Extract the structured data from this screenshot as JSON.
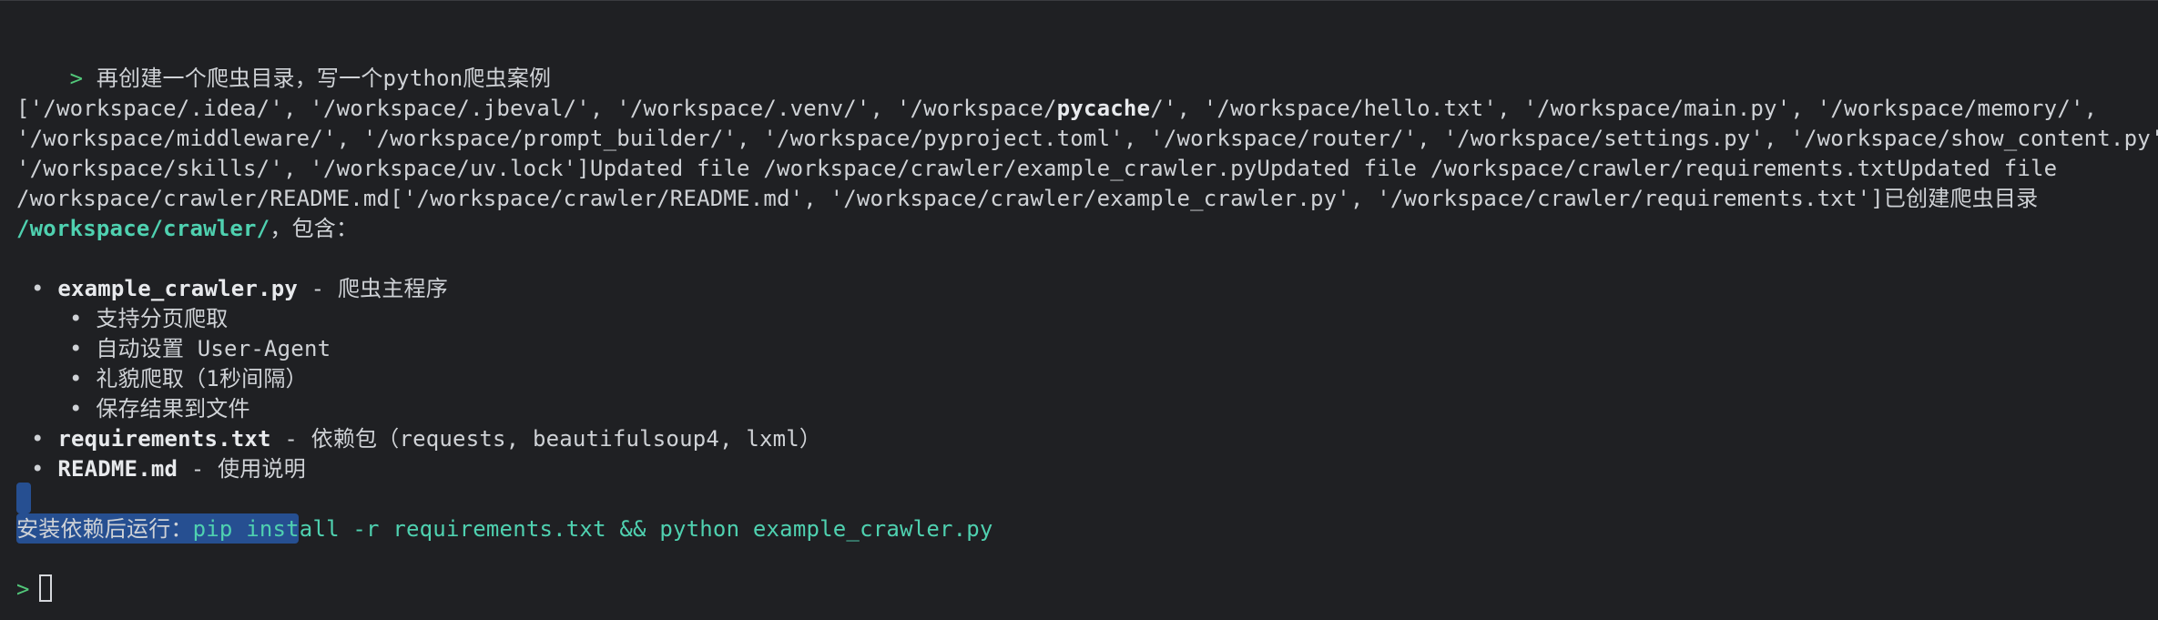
{
  "prompt_symbol": ">",
  "user_message": "再创建一个爬虫目录，写一个python爬虫案例",
  "output": {
    "line1_a": "['/workspace/.idea/', '/workspace/.jbeval/', '/workspace/.venv/', '/workspace/",
    "line1_bold": "pycache",
    "line1_b": "/', '/workspace/hello.txt', '/workspace/main.py', '/workspace/memory/',",
    "line2": "'/workspace/middleware/', '/workspace/prompt_builder/', '/workspace/pyproject.toml', '/workspace/router/', '/workspace/settings.py', '/workspace/show_content.py',",
    "line3": "'/workspace/skills/', '/workspace/uv.lock']Updated file /workspace/crawler/example_crawler.pyUpdated file /workspace/crawler/requirements.txtUpdated file",
    "line4": "/workspace/crawler/README.md['/workspace/crawler/README.md', '/workspace/crawler/example_crawler.py', '/workspace/crawler/requirements.txt']已创建爬虫目录",
    "line5_path": "/workspace/crawler/",
    "line5_rest": "，包含："
  },
  "files": [
    {
      "name": "example_crawler.py",
      "desc": " - 爬虫主程序",
      "features": [
        "支持分页爬取",
        "自动设置 User-Agent",
        "礼貌爬取（1秒间隔）",
        "保存结果到文件"
      ]
    },
    {
      "name": "requirements.txt",
      "desc": " - 依赖包（requests, beautifulsoup4, lxml）"
    },
    {
      "name": "README.md",
      "desc": " - 使用说明"
    }
  ],
  "bullet": "•",
  "install": {
    "label": "安装依赖后运行：",
    "command": "pip install -r requirements.txt && python example_crawler.py"
  },
  "colors": {
    "background": "#1f2023",
    "prompt": "#52c77a",
    "accent": "#4fd1b0",
    "selection": "#264f91"
  },
  "icons": {
    "cursor": "block-cursor-icon"
  }
}
